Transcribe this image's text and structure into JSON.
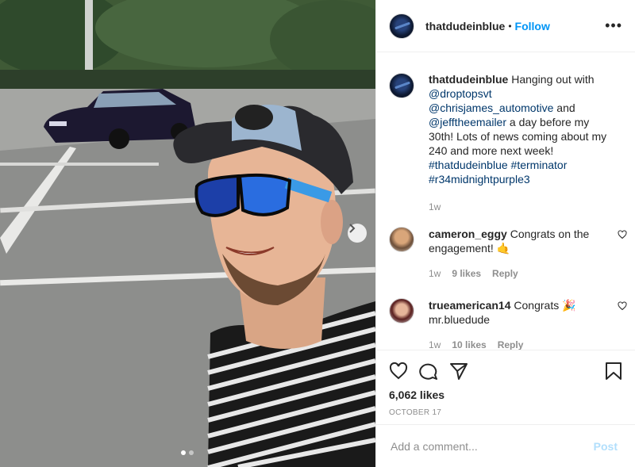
{
  "post": {
    "username": "thatdudeinblue",
    "separator": "•",
    "follow_label": "Follow",
    "more_label": "•••",
    "caption": {
      "username": "thatdudeinblue",
      "t1": " Hanging out with ",
      "mention1": "@droptopsvt",
      "t2": " ",
      "mention2": "@chrisjames_automotive",
      "t3": " and ",
      "mention3": "@jefftheemailer",
      "t4": " a day before my 30th! Lots of news coming about my 240 and more next week! ",
      "tag1": "#thatdudeinblue",
      "t5": " ",
      "tag2": "#terminator",
      "t6": " ",
      "tag3": "#r34midnightpurple3",
      "time": "1w"
    },
    "comments": [
      {
        "username": "cameron_eggy",
        "text": " Congrats on the engagement! 🤙",
        "time": "1w",
        "likes": "9 likes",
        "reply": "Reply"
      },
      {
        "username": "trueamerican14",
        "text": " Congrats 🎉 mr.bluedude",
        "time": "1w",
        "likes": "10 likes",
        "reply": "Reply"
      }
    ],
    "likes": "6,062 likes",
    "date": "OCTOBER 17",
    "comment_placeholder": "Add a comment...",
    "post_label": "Post"
  },
  "carousel": {
    "slide_count": 2,
    "active_index": 0
  },
  "colors": {
    "accent": "#0095f6",
    "link": "#00376b",
    "muted": "#8e8e8e",
    "post_disabled": "#b2dffc"
  },
  "icons": [
    "chevron-right-icon",
    "heart-icon",
    "comment-icon",
    "share-icon",
    "bookmark-icon",
    "more-icon"
  ]
}
